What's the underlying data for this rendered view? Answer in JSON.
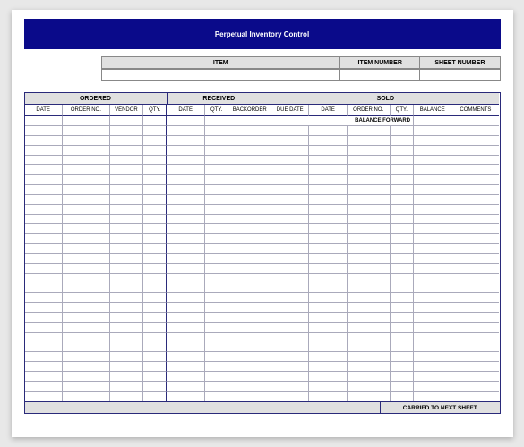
{
  "title": "Perpetual Inventory Control",
  "info": {
    "item_label": "ITEM",
    "item_value": "",
    "item_number_label": "ITEM NUMBER",
    "item_number_value": "",
    "sheet_number_label": "SHEET NUMBER",
    "sheet_number_value": ""
  },
  "sections": {
    "ordered": "ORDERED",
    "received": "RECEIVED",
    "sold": "SOLD"
  },
  "columns": {
    "date": "DATE",
    "order_no": "ORDER NO.",
    "vendor": "VENDOR",
    "qty": "QTY.",
    "r_date": "DATE",
    "r_qty": "QTY.",
    "backorder": "BACKORDER",
    "due_date": "DUE DATE",
    "s_date": "DATE",
    "s_order_no": "ORDER NO.",
    "s_qty": "QTY.",
    "balance": "BALANCE",
    "comments": "COMMENTS"
  },
  "balance_forward_label": "BALANCE FORWARD",
  "carried_label": "CARRIED TO NEXT SHEET",
  "row_count": 28
}
